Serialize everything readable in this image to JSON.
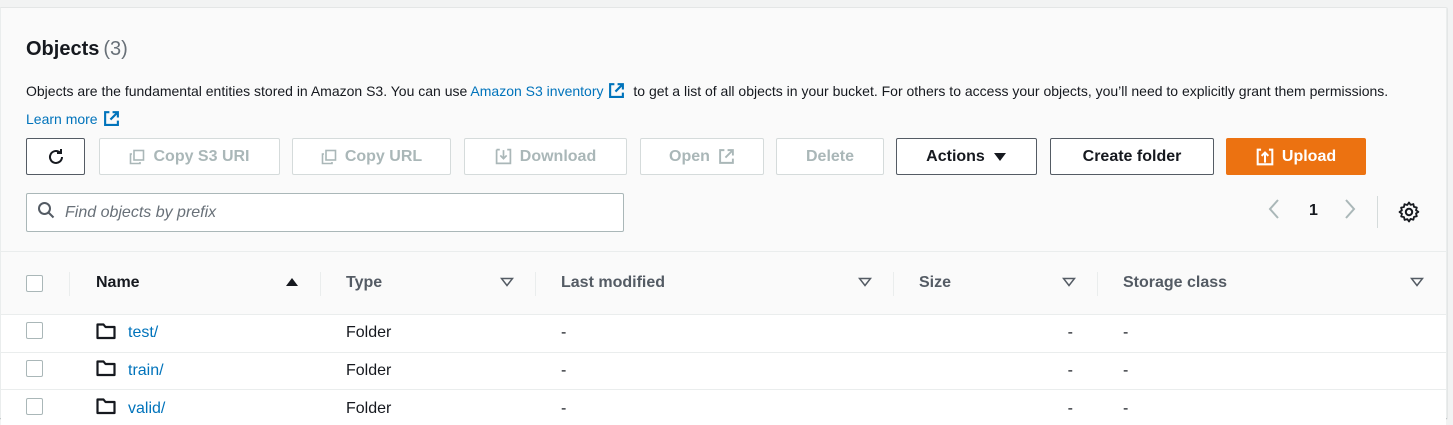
{
  "header": {
    "title": "Objects",
    "count": "(3)",
    "desc_1": "Objects are the fundamental entities stored in Amazon S3. You can use",
    "inventory_link": "Amazon S3 inventory",
    "desc_2": "to get a list of all objects in your bucket. For others to access your objects, you’ll need to explicitly grant them permissions.",
    "learn_more": "Learn more"
  },
  "toolbar": {
    "copy_s3_uri": "Copy S3 URI",
    "copy_url": "Copy URL",
    "download": "Download",
    "open": "Open",
    "delete": "Delete",
    "actions": "Actions",
    "create_folder": "Create folder",
    "upload": "Upload"
  },
  "search": {
    "placeholder": "Find objects by prefix"
  },
  "pagination": {
    "page": "1"
  },
  "table": {
    "columns": {
      "name": "Name",
      "type": "Type",
      "last_modified": "Last modified",
      "size": "Size",
      "storage_class": "Storage class"
    },
    "rows": [
      {
        "name": "test/",
        "type": "Folder",
        "last_modified": "-",
        "size": "-",
        "storage_class": "-"
      },
      {
        "name": "train/",
        "type": "Folder",
        "last_modified": "-",
        "size": "-",
        "storage_class": "-"
      },
      {
        "name": "valid/",
        "type": "Folder",
        "last_modified": "-",
        "size": "-",
        "storage_class": "-"
      }
    ]
  },
  "colors": {
    "link": "#0073bb",
    "primary": "#ec7211",
    "text": "#16191f",
    "muted": "#545b64",
    "disabled": "#aab7b8"
  },
  "icons": [
    "refresh-icon",
    "copy-icon",
    "download-icon",
    "external-link-icon",
    "caret-down-icon",
    "upload-icon",
    "search-icon",
    "chevron-left-icon",
    "chevron-right-icon",
    "gear-icon",
    "sort-ascending-icon",
    "sort-icon",
    "folder-icon"
  ]
}
